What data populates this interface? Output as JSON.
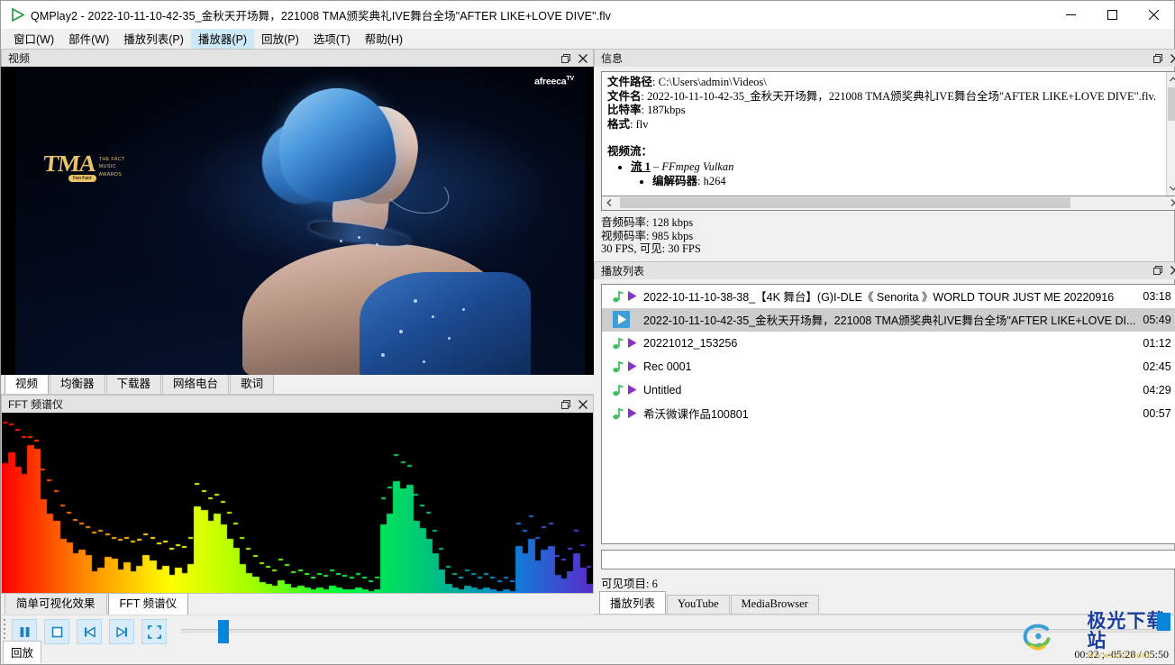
{
  "window": {
    "title": "QMPlay2 - 2022-10-11-10-42-35_金秋天开场舞，221008 TMA颁奖典礼IVE舞台全场\"AFTER LIKE+LOVE DIVE\".flv",
    "app_icon": "play-icon",
    "minimize": "–",
    "maximize": "□",
    "close": "✕"
  },
  "menu": {
    "items": [
      {
        "label": "窗口(W)",
        "active": false
      },
      {
        "label": "部件(W)",
        "active": false
      },
      {
        "label": "播放列表(P)",
        "active": false
      },
      {
        "label": "播放器(P)",
        "active": true
      },
      {
        "label": "回放(P)",
        "active": false
      },
      {
        "label": "选项(T)",
        "active": false
      },
      {
        "label": "帮助(H)",
        "active": false
      }
    ]
  },
  "video_dock": {
    "title": "视频",
    "float_btn": "❐",
    "close_btn": "✕",
    "overlay_logo": "TMA",
    "overlay_logo_sub_1": "THE FACT",
    "overlay_logo_sub_2": "MUSIC",
    "overlay_logo_sub_3": "AWARDS",
    "overlay_pill": "Fan Fact",
    "overlay_brand": "afreeca",
    "overlay_brand_sup": "TV"
  },
  "video_tabs": [
    {
      "label": "视频",
      "active": true
    },
    {
      "label": "均衡器",
      "active": false
    },
    {
      "label": "下载器",
      "active": false
    },
    {
      "label": "网络电台",
      "active": false
    },
    {
      "label": "歌词",
      "active": false
    }
  ],
  "fft_dock": {
    "title": "FFT 频谱仪",
    "float_btn": "❐",
    "close_btn": "✕"
  },
  "visual_tabs": [
    {
      "label": "简单可视化效果",
      "active": false
    },
    {
      "label": "FFT 频谱仪",
      "active": true
    }
  ],
  "info_dock": {
    "title": "信息",
    "float_btn": "❐",
    "close_btn": "✕",
    "fields": [
      {
        "key": "文件路径",
        "value": "C:\\Users\\admin\\Videos\\"
      },
      {
        "key": "文件名",
        "value": "2022-10-11-10-42-35_金秋天开场舞，221008 TMA颁奖典礼IVE舞台全场\"AFTER LIKE+LOVE DIVE\".flv."
      },
      {
        "key": "比特率",
        "value": "187kbps"
      },
      {
        "key": "格式",
        "value": "flv"
      }
    ],
    "stream_header": "视频流：",
    "stream_item": "流 1",
    "stream_item_detail": " – FFmpeg  Vulkan",
    "codec_key": "编解码器",
    "codec_value": "h264",
    "stats": [
      "音频码率: 128 kbps",
      "视频码率: 985 kbps",
      "30 FPS, 可见: 30 FPS"
    ]
  },
  "playlist_dock": {
    "title": "播放列表",
    "float_btn": "❐",
    "close_btn": "✕",
    "search_value": "",
    "search_placeholder": "",
    "count_label": "可见项目: 6",
    "items": [
      {
        "name": "2022-10-11-10-38-38_【4K 舞台】(G)I-DLE《 Senorita 》WORLD TOUR JUST ME 20220916",
        "time": "03:18",
        "selected": false
      },
      {
        "name": "2022-10-11-10-42-35_金秋天开场舞，221008 TMA颁奖典礼IVE舞台全场\"AFTER LIKE+LOVE DI...",
        "time": "05:49",
        "selected": true
      },
      {
        "name": "20221012_153256",
        "time": "01:12",
        "selected": false
      },
      {
        "name": "Rec 0001",
        "time": "02:45",
        "selected": false
      },
      {
        "name": "Untitled",
        "time": "04:29",
        "selected": false
      },
      {
        "name": "希沃微课作品100801",
        "time": "00:57",
        "selected": false
      }
    ],
    "tabs": [
      {
        "label": "播放列表",
        "active": true
      },
      {
        "label": "YouTube",
        "active": false
      },
      {
        "label": "MediaBrowser",
        "active": false
      }
    ]
  },
  "playback_bar": {
    "tab_label": "回放",
    "buttons": [
      {
        "name": "pause-button",
        "icon": "pause-icon"
      },
      {
        "name": "stop-button",
        "icon": "stop-icon"
      },
      {
        "name": "previous-button",
        "icon": "previous-icon"
      },
      {
        "name": "next-button",
        "icon": "next-icon"
      },
      {
        "name": "fullscreen-button",
        "icon": "fullscreen-icon"
      }
    ],
    "time_display": "00:22 ; -05:28 / 05:50",
    "seek_percent": 6.5
  },
  "watermark": {
    "main": "极光下载站",
    "sub": "www.xz7.com"
  },
  "colors": {
    "accent": "#0a84d8",
    "menu_active": "#cde8f6",
    "selection": "#cdcdcd",
    "panel_header": "#e3e3e3"
  },
  "chart_data": {
    "type": "bar",
    "title": "FFT 频谱仪",
    "xlabel": "",
    "ylabel": "",
    "ylim": [
      0,
      1
    ],
    "grid": false,
    "legend": "none",
    "background": "#000000",
    "gradient_stops": [
      "#ff0000",
      "#ff8c00",
      "#ffff00",
      "#9dff00",
      "#00ff3c",
      "#00c878",
      "#0a84d8",
      "#5a2ccc"
    ],
    "bar_count": 92,
    "values": [
      0.72,
      0.78,
      0.7,
      0.66,
      0.82,
      0.8,
      0.52,
      0.44,
      0.4,
      0.3,
      0.28,
      0.22,
      0.24,
      0.21,
      0.12,
      0.14,
      0.2,
      0.19,
      0.13,
      0.17,
      0.12,
      0.15,
      0.21,
      0.18,
      0.13,
      0.15,
      0.1,
      0.14,
      0.11,
      0.16,
      0.48,
      0.46,
      0.4,
      0.44,
      0.38,
      0.3,
      0.25,
      0.16,
      0.11,
      0.09,
      0.06,
      0.05,
      0.04,
      0.07,
      0.05,
      0.03,
      0.04,
      0.03,
      0.02,
      0.03,
      0.02,
      0.04,
      0.03,
      0.02,
      0.02,
      0.03,
      0.02,
      0.01,
      0.02,
      0.38,
      0.44,
      0.62,
      0.58,
      0.6,
      0.4,
      0.36,
      0.3,
      0.22,
      0.13,
      0.05,
      0.03,
      0.02,
      0.04,
      0.03,
      0.02,
      0.03,
      0.02,
      0.01,
      0.02,
      0.01,
      0.26,
      0.22,
      0.3,
      0.18,
      0.24,
      0.26,
      0.1,
      0.08,
      0.12,
      0.22,
      0.14,
      0.05
    ],
    "peaks": [
      0.94,
      0.93,
      0.9,
      0.86,
      0.86,
      0.84,
      0.68,
      0.62,
      0.56,
      0.48,
      0.44,
      0.4,
      0.38,
      0.36,
      0.33,
      0.34,
      0.32,
      0.3,
      0.29,
      0.3,
      0.28,
      0.29,
      0.32,
      0.3,
      0.27,
      0.28,
      0.24,
      0.26,
      0.25,
      0.3,
      0.6,
      0.56,
      0.52,
      0.54,
      0.5,
      0.44,
      0.38,
      0.3,
      0.24,
      0.2,
      0.16,
      0.14,
      0.12,
      0.18,
      0.15,
      0.11,
      0.12,
      0.1,
      0.08,
      0.1,
      0.09,
      0.12,
      0.1,
      0.09,
      0.08,
      0.1,
      0.08,
      0.06,
      0.08,
      0.52,
      0.58,
      0.76,
      0.72,
      0.7,
      0.54,
      0.48,
      0.44,
      0.34,
      0.24,
      0.14,
      0.1,
      0.08,
      0.12,
      0.1,
      0.08,
      0.1,
      0.08,
      0.06,
      0.08,
      0.06,
      0.38,
      0.34,
      0.42,
      0.3,
      0.36,
      0.38,
      0.2,
      0.18,
      0.24,
      0.34,
      0.26,
      0.14
    ]
  }
}
